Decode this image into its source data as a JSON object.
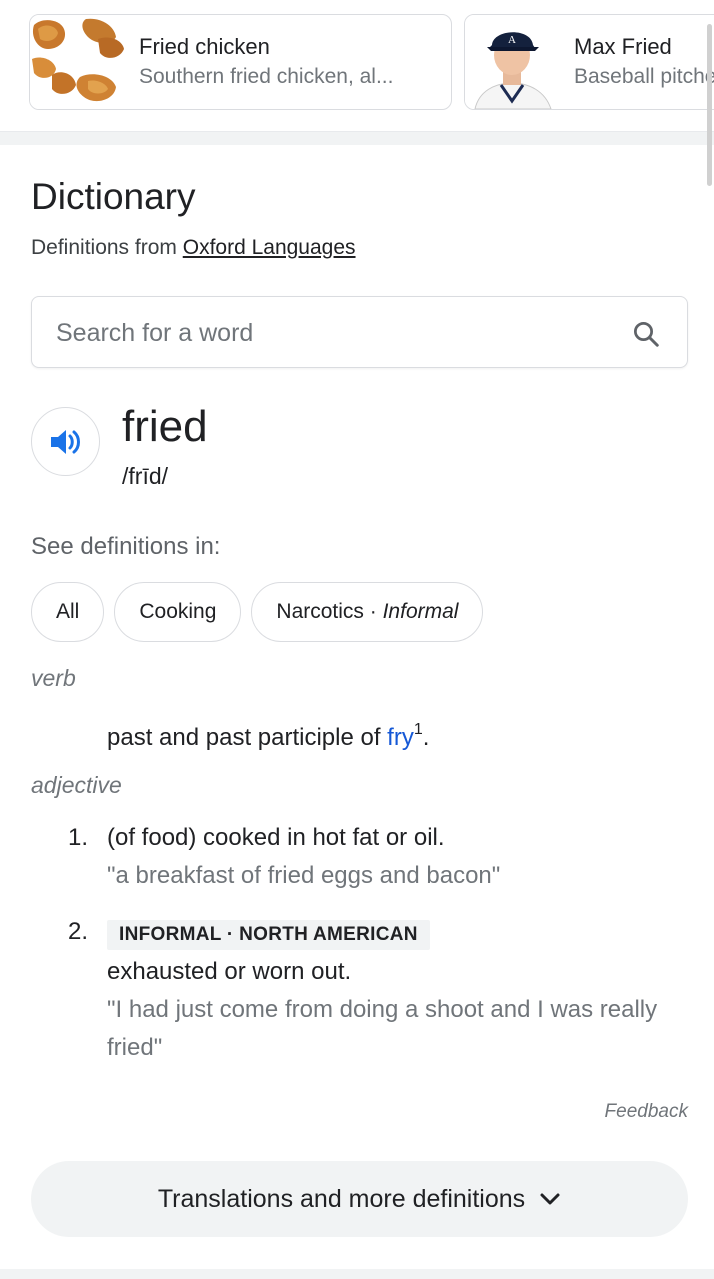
{
  "cards": [
    {
      "title": "Fried chicken",
      "subtitle": "Southern fried chicken, al..."
    },
    {
      "title": "Max Fried",
      "subtitle": "Baseball pitcher"
    }
  ],
  "dictionary": {
    "heading": "Dictionary",
    "source_prefix": "Definitions from",
    "source_link": "Oxford Languages",
    "search_placeholder": "Search for a word",
    "word": "fried",
    "phonetic": "/frīd/",
    "see_definitions_label": "See definitions in:",
    "chips": [
      {
        "label": "All",
        "qualifier": ""
      },
      {
        "label": "Cooking",
        "qualifier": ""
      },
      {
        "label": "Narcotics · ",
        "qualifier": "Informal"
      }
    ],
    "verb": {
      "pos": "verb",
      "definition_prefix": "past and past participle of ",
      "link": "fry",
      "superscript": "1",
      "suffix": "."
    },
    "adjective": {
      "pos": "adjective",
      "senses": [
        {
          "number": "1.",
          "tag": "",
          "definition": "(of food) cooked in hot fat or oil.",
          "example": "\"a breakfast of fried eggs and bacon\""
        },
        {
          "number": "2.",
          "tag": "INFORMAL · NORTH AMERICAN",
          "definition": "exhausted or worn out.",
          "example": "\"I had just come from doing a shoot and I was really fried\""
        }
      ]
    },
    "feedback": "Feedback",
    "more_button": "Translations and more definitions"
  },
  "colors": {
    "accent_blue": "#1a73e8",
    "link_blue": "#1558d6",
    "text_primary": "#202124",
    "text_secondary": "#70757a"
  },
  "icons": {
    "search": "search-icon",
    "speaker": "speaker-icon",
    "chevron": "chevron-down-icon"
  }
}
